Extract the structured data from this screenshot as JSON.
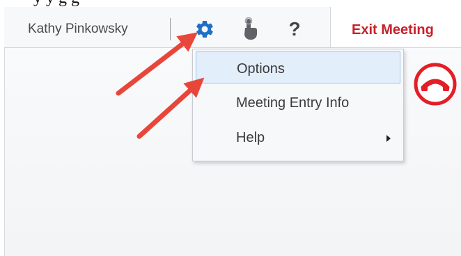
{
  "page_top_fragment": "y  y              g g",
  "toolbar": {
    "user_name": "Kathy Pinkowsky",
    "icons": {
      "gear": "gear-icon",
      "hand": "raise-hand-icon",
      "help": "help-icon"
    },
    "help_glyph": "?",
    "exit_label": "Exit Meeting"
  },
  "hangup": {
    "icon": "hang-up-icon",
    "color": "#e21f26"
  },
  "menu": {
    "items": [
      {
        "label": "Options",
        "selected": true
      },
      {
        "label": "Meeting Entry Info",
        "selected": false
      },
      {
        "label": "Help",
        "selected": false,
        "has_submenu": true
      }
    ]
  },
  "annotations": {
    "arrow_color": "#e8463a"
  },
  "colors": {
    "accent_blue": "#1f6fc8",
    "exit_red": "#c8202a",
    "selection_bg": "#e3eefb",
    "selection_border": "#9cc3ec"
  }
}
